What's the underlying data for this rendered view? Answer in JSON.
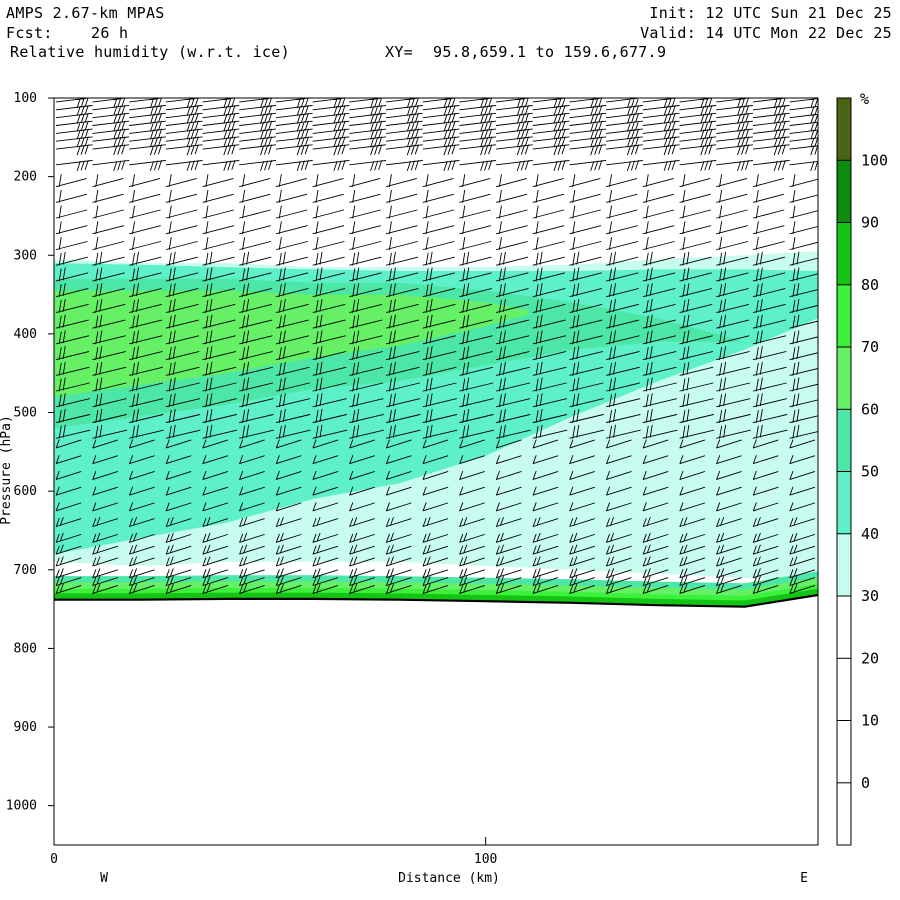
{
  "header": {
    "model": "AMPS 2.67-km MPAS",
    "fcst_label": "Fcst:",
    "fcst_value": "26 h",
    "field": "Relative humidity (w.r.t. ice)",
    "xy_label": "XY=",
    "xy_value": "95.8,659.1 to 159.6,677.9",
    "init": "Init: 12 UTC Sun 21 Dec 25",
    "valid": "Valid: 14 UTC Mon 22 Dec 25"
  },
  "chart_data": {
    "type": "heatmap",
    "title": "Relative humidity (w.r.t. ice)",
    "xlabel": "Distance (km)",
    "ylabel": "Pressure (hPa)",
    "xlim": [
      0,
      177
    ],
    "ylim": [
      1050,
      100
    ],
    "x_ticks": [
      0,
      100
    ],
    "y_ticks": [
      100,
      200,
      300,
      400,
      500,
      600,
      700,
      800,
      900,
      1000
    ],
    "x_end_labels": [
      "W",
      "E"
    ],
    "colorbar": {
      "unit": "%",
      "levels": [
        -10,
        0,
        10,
        20,
        30,
        40,
        50,
        60,
        70,
        80,
        90,
        100,
        110
      ],
      "tick_labels": [
        0,
        10,
        20,
        30,
        40,
        50,
        60,
        70,
        80,
        90,
        100
      ],
      "colors": [
        "#ffffff",
        "#ffffff",
        "#ffffff",
        "#ffffff",
        "#c8fcee",
        "#5ef0c8",
        "#4ce6a6",
        "#66f066",
        "#3cf03c",
        "#14c414",
        "#0c8c0c",
        "#4a6414"
      ]
    },
    "rh_layers": [
      {
        "level": 30,
        "x": [
          0,
          20,
          40,
          60,
          80,
          100,
          120,
          140,
          160,
          177
        ],
        "p_top": [
          305,
          310,
          310,
          315,
          315,
          315,
          312,
          305,
          300,
          295
        ],
        "p_bottom": [
          690,
          695,
          690,
          690,
          690,
          695,
          700,
          705,
          710,
          715
        ]
      },
      {
        "level": 40,
        "x": [
          0,
          20,
          40,
          60,
          80,
          100,
          120,
          140,
          160,
          177
        ],
        "p_top": [
          310,
          312,
          315,
          318,
          320,
          320,
          320,
          318,
          318,
          320
        ],
        "p_bottom": [
          680,
          660,
          640,
          610,
          590,
          555,
          505,
          460,
          420,
          380
        ]
      },
      {
        "level": 50,
        "x": [
          0,
          20,
          40,
          60,
          80,
          100,
          120,
          140,
          160,
          177
        ],
        "p_top": [
          330,
          330,
          330,
          335,
          335,
          345,
          360,
          380,
          410,
          430
        ],
        "p_bottom": [
          520,
          505,
          490,
          470,
          460,
          440,
          420,
          410,
          410,
          430
        ]
      },
      {
        "level": 60,
        "x": [
          0,
          20,
          40,
          60,
          80,
          100,
          110
        ],
        "p_top": [
          345,
          345,
          345,
          350,
          350,
          360,
          370
        ],
        "p_bottom": [
          480,
          465,
          450,
          430,
          415,
          390,
          375
        ]
      }
    ],
    "surface_band": {
      "x": [
        0,
        20,
        40,
        60,
        80,
        100,
        120,
        140,
        160,
        177
      ],
      "p_surface": [
        738,
        738,
        737,
        737,
        738,
        740,
        742,
        745,
        747,
        732
      ],
      "levels": [
        {
          "level": 50,
          "depth_hpa": 30
        },
        {
          "level": 60,
          "depth_hpa": 22
        },
        {
          "level": 70,
          "depth_hpa": 14
        },
        {
          "level": 80,
          "depth_hpa": 8
        }
      ]
    },
    "wind_barbs": {
      "columns_x": [
        0.5,
        9,
        17.5,
        26,
        34.5,
        43,
        51.5,
        60,
        68.5,
        77,
        85.5,
        94,
        102.5,
        111,
        119.5,
        128,
        136.5,
        145,
        153.5,
        162,
        170.5
      ],
      "pressure_levels": [
        105,
        115,
        125,
        135,
        145,
        155,
        165,
        185,
        205,
        225,
        245,
        265,
        285,
        305,
        325,
        345,
        365,
        385,
        405,
        425,
        445,
        465,
        485,
        505,
        525,
        545,
        565,
        585,
        605,
        625,
        645,
        665,
        680,
        695,
        710,
        720,
        730
      ]
    }
  }
}
